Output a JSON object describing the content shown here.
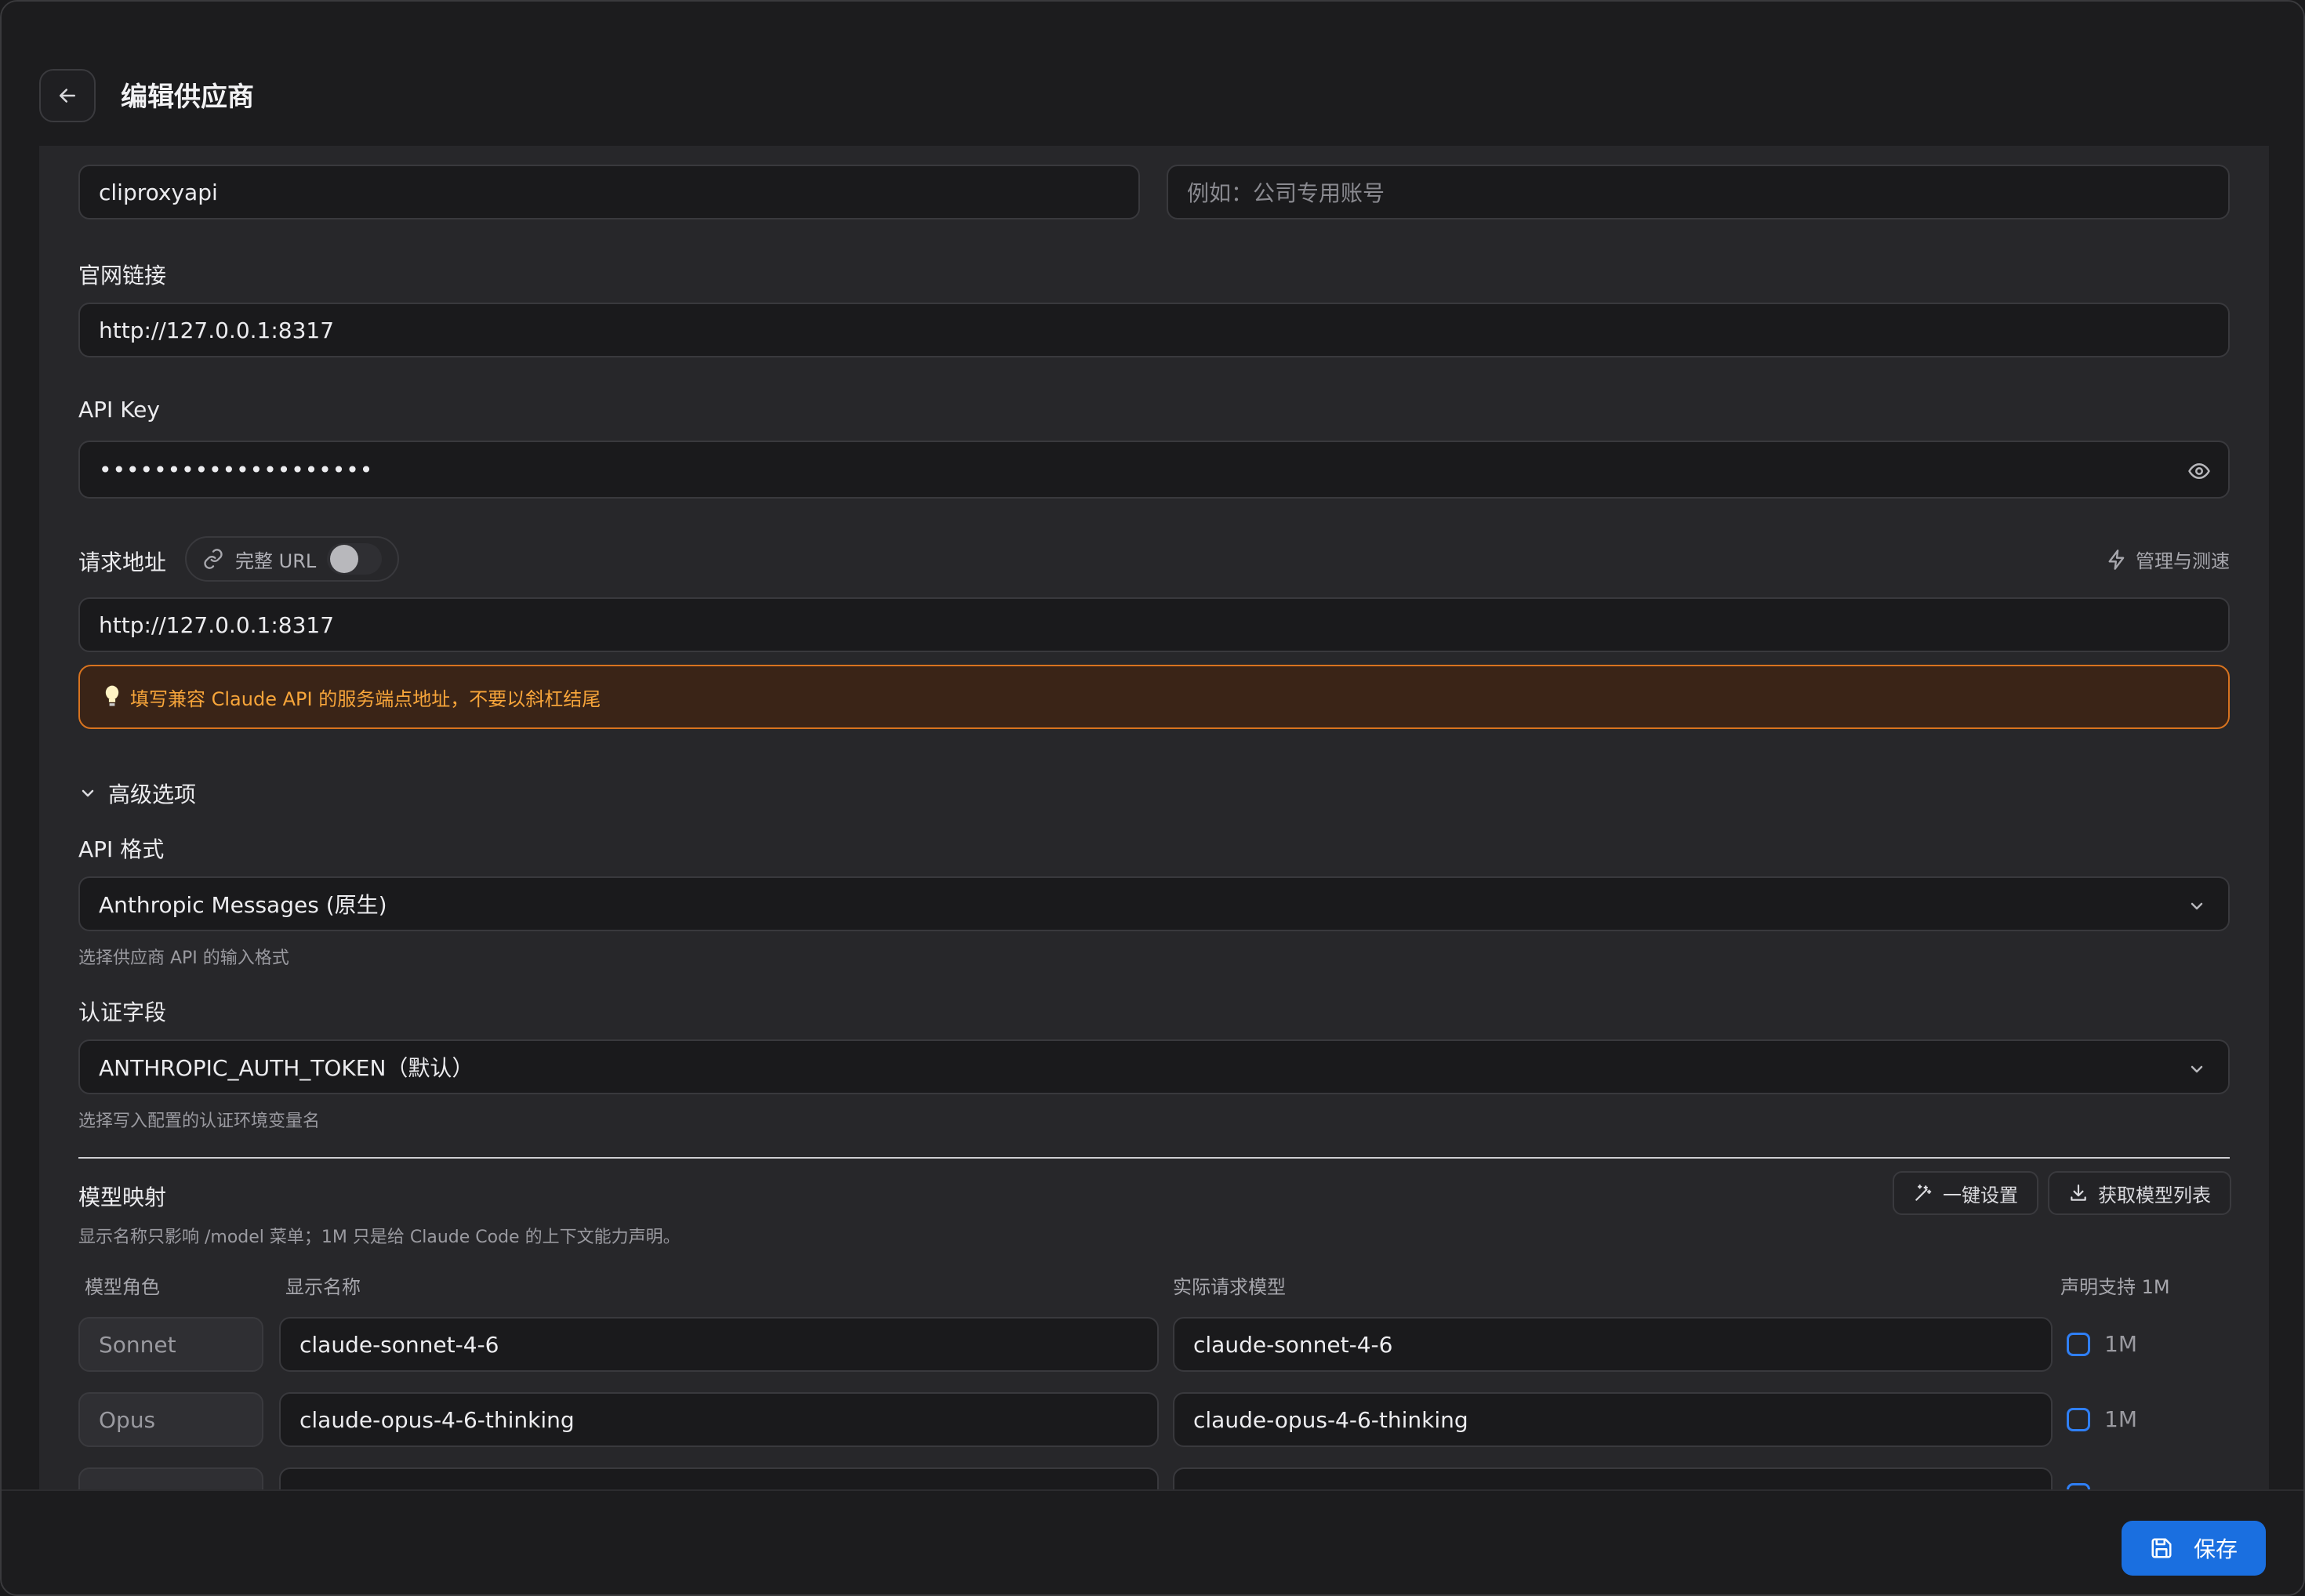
{
  "window": {
    "title": "编辑供应商"
  },
  "form": {
    "name_value": "cliproxyapi",
    "notes_placeholder": "例如：公司专用账号",
    "website_label": "官网链接",
    "website_value": "http://127.0.0.1:8317",
    "api_key_label": "API Key",
    "api_key_masked": "••••••••••••••••••••",
    "endpoint_label": "请求地址",
    "full_url_label": "完整 URL",
    "manage_label": "管理与测速",
    "endpoint_value": "http://127.0.0.1:8317",
    "endpoint_hint": "填写兼容 Claude API 的服务端点地址，不要以斜杠结尾",
    "advanced_label": "高级选项",
    "api_format_label": "API 格式",
    "api_format_value": "Anthropic Messages (原生)",
    "api_format_hint": "选择供应商 API 的输入格式",
    "auth_field_label": "认证字段",
    "auth_field_value": "ANTHROPIC_AUTH_TOKEN（默认）",
    "auth_field_hint": "选择写入配置的认证环境变量名"
  },
  "model_mapping": {
    "title": "模型映射",
    "description": "显示名称只影响 /model 菜单；1M 只是给 Claude Code 的上下文能力声明。",
    "one_click_label": "一键设置",
    "fetch_models_label": "获取模型列表",
    "columns": {
      "role": "模型角色",
      "display": "显示名称",
      "actual": "实际请求模型",
      "support_1m": "声明支持 1M"
    },
    "rows": [
      {
        "role": "Sonnet",
        "display": "claude-sonnet-4-6",
        "actual": "claude-sonnet-4-6",
        "flag": "1M"
      },
      {
        "role": "Opus",
        "display": "claude-opus-4-6-thinking",
        "actual": "claude-opus-4-6-thinking",
        "flag": "1M"
      }
    ]
  },
  "footer": {
    "save_label": "保存"
  },
  "colors": {
    "accent": "#1a6fe0",
    "warning": "#f7a53a",
    "checkbox": "#2f7ff5"
  }
}
